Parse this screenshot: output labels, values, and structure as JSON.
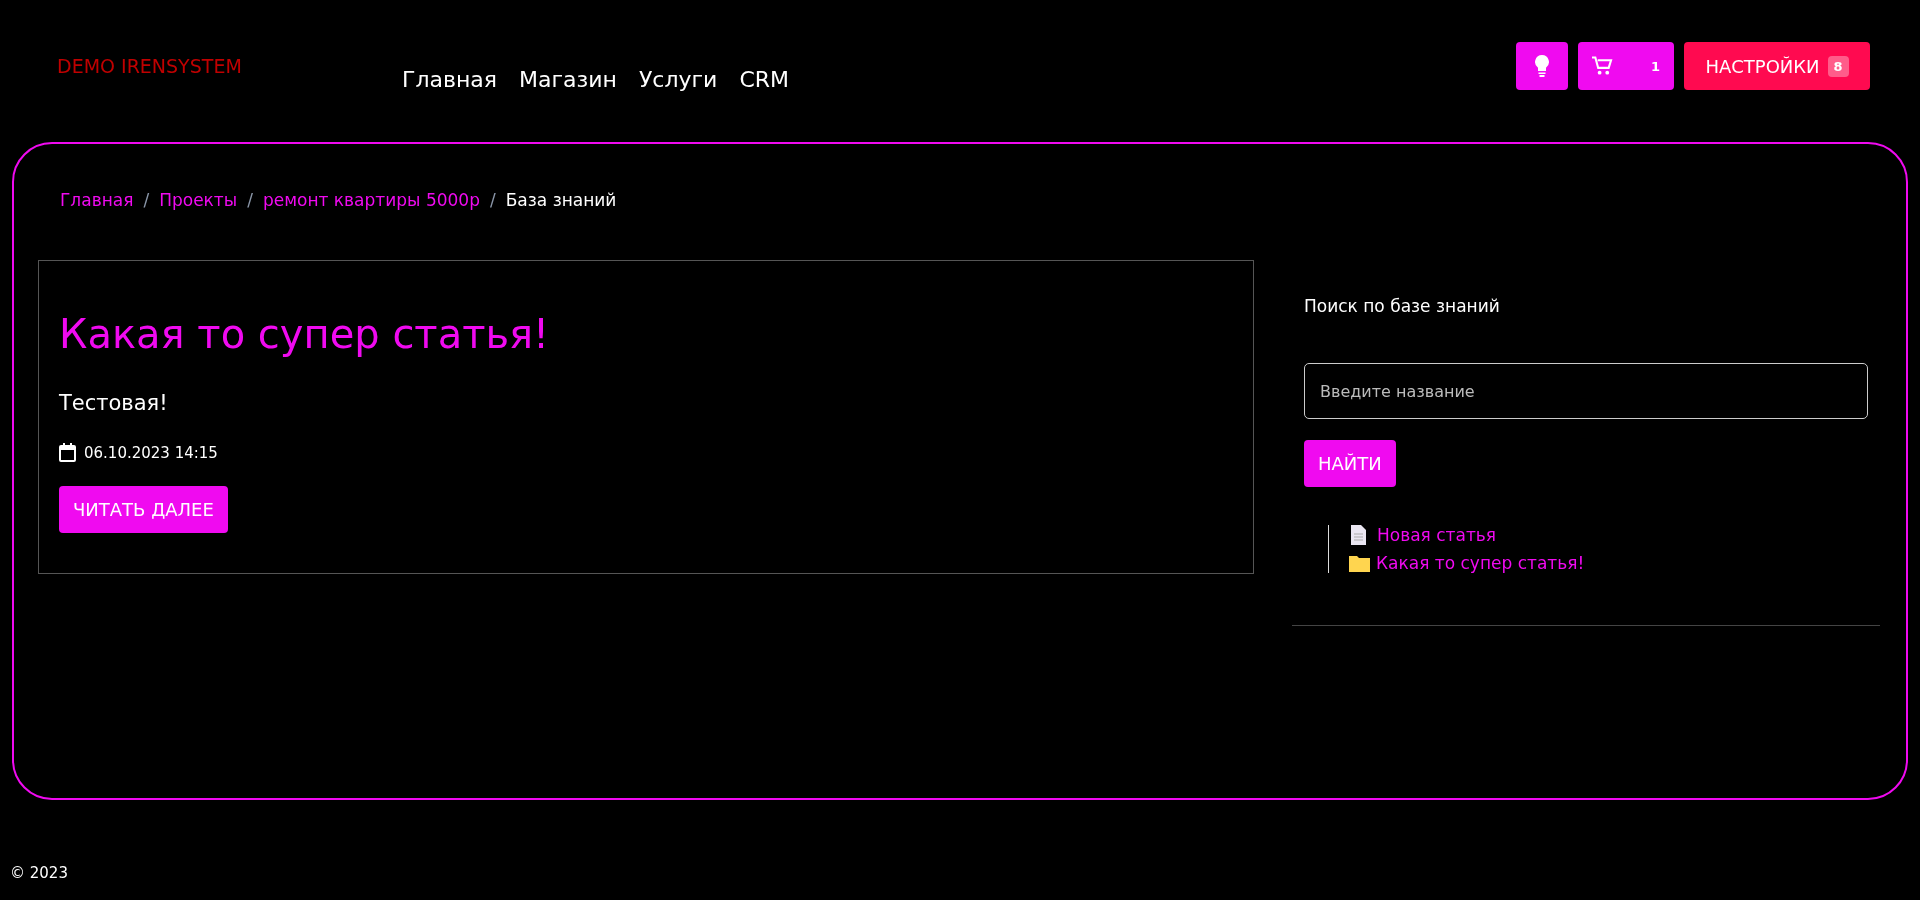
{
  "header": {
    "logo": "DEMO IRENSYSTEM",
    "nav": [
      "Главная",
      "Магазин",
      "Услуги",
      "CRM"
    ],
    "cart_count": "1",
    "settings": {
      "label": "НАСТРОЙКИ",
      "badge": "8"
    }
  },
  "breadcrumb": [
    {
      "label": "Главная",
      "kind": "link"
    },
    {
      "separator": "/",
      "label": "Проекты",
      "kind": "link"
    },
    {
      "separator": "/",
      "label": "ремонт квартиры 5000р",
      "kind": "link"
    },
    {
      "separator": "/",
      "label": "База знаний",
      "kind": "current"
    }
  ],
  "article": {
    "title": "Какая то супер статья!",
    "summary": "Тестовая!",
    "date": "06.10.2023 14:15",
    "button": "ЧИТАТЬ ДАЛЕЕ"
  },
  "search": {
    "label": "Поиск по базе знаний",
    "placeholder": "Введите название",
    "button": "НАЙТИ"
  },
  "tree": [
    {
      "label": "Новая статья",
      "kind": "document"
    },
    {
      "label": "Какая то супер статья!",
      "kind": "folder"
    }
  ],
  "footer": "© 2023"
}
